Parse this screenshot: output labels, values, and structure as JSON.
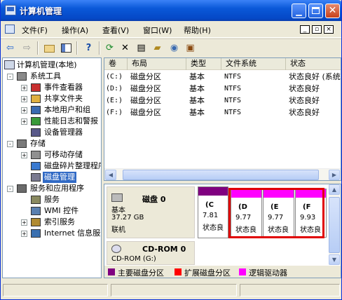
{
  "window": {
    "title": "计算机管理"
  },
  "menu": [
    "文件(F)",
    "操作(A)",
    "查看(V)",
    "窗口(W)",
    "帮助(H)"
  ],
  "mdi_buttons": [
    "_",
    "ð",
    "×"
  ],
  "toolbar_icons": [
    "back-arrow-icon",
    "forward-arrow-icon",
    "up-folder-icon",
    "show-tree-icon",
    "help-icon",
    "refresh-icon",
    "delete-icon",
    "properties-icon",
    "open-folder-icon",
    "search-icon",
    "export-icon"
  ],
  "tree": {
    "root": "计算机管理(本地)",
    "nodes": [
      {
        "label": "系统工具",
        "level": 1,
        "expander": "-",
        "icon": "tools"
      },
      {
        "label": "事件查看器",
        "level": 2,
        "expander": "+",
        "icon": "event"
      },
      {
        "label": "共享文件夹",
        "level": 2,
        "expander": "+",
        "icon": "share"
      },
      {
        "label": "本地用户和组",
        "level": 2,
        "expander": "+",
        "icon": "users"
      },
      {
        "label": "性能日志和警报",
        "level": 2,
        "expander": "+",
        "icon": "perf"
      },
      {
        "label": "设备管理器",
        "level": 2,
        "expander": "",
        "icon": "device"
      },
      {
        "label": "存储",
        "level": 1,
        "expander": "-",
        "icon": "storage"
      },
      {
        "label": "可移动存储",
        "level": 2,
        "expander": "+",
        "icon": "removable"
      },
      {
        "label": "磁盘碎片整理程序",
        "level": 2,
        "expander": "",
        "icon": "defrag"
      },
      {
        "label": "磁盘管理",
        "level": 2,
        "expander": "",
        "icon": "diskmgmt",
        "selected": true
      },
      {
        "label": "服务和应用程序",
        "level": 1,
        "expander": "-",
        "icon": "services-apps"
      },
      {
        "label": "服务",
        "level": 2,
        "expander": "",
        "icon": "services"
      },
      {
        "label": "WMI 控件",
        "level": 2,
        "expander": "",
        "icon": "wmi"
      },
      {
        "label": "索引服务",
        "level": 2,
        "expander": "+",
        "icon": "index"
      },
      {
        "label": "Internet 信息服务",
        "level": 2,
        "expander": "+",
        "icon": "iis"
      }
    ]
  },
  "list": {
    "columns": [
      "卷",
      "布局",
      "类型",
      "文件系统",
      "状态"
    ],
    "rows": [
      [
        "(C:)",
        "磁盘分区",
        "基本",
        "NTFS",
        "状态良好 (系统"
      ],
      [
        "(D:)",
        "磁盘分区",
        "基本",
        "NTFS",
        "状态良好"
      ],
      [
        "(E:)",
        "磁盘分区",
        "基本",
        "NTFS",
        "状态良好"
      ],
      [
        "(F:)",
        "磁盘分区",
        "基本",
        "NTFS",
        "状态良好"
      ]
    ]
  },
  "disk0": {
    "name": "磁盘 0",
    "type": "基本",
    "size": "37.27 GB",
    "status": "联机",
    "partitions": [
      {
        "label": "(C",
        "size": "7.81",
        "status": "状态良",
        "kind": "primary"
      },
      {
        "label": "(D",
        "size": "9.77",
        "status": "状态良",
        "kind": "logical"
      },
      {
        "label": "(E",
        "size": "9.77",
        "status": "状态良",
        "kind": "logical"
      },
      {
        "label": "(F",
        "size": "9.93",
        "status": "状态良",
        "kind": "logical"
      }
    ]
  },
  "cdrom": {
    "name": "CD-ROM 0",
    "drive": "CD-ROM (G:)"
  },
  "legend": [
    {
      "label": "主要磁盘分区",
      "color": "#800080"
    },
    {
      "label": "扩展磁盘分区",
      "color": "#ff0000"
    },
    {
      "label": "逻辑驱动器",
      "color": "#ff00ff"
    }
  ],
  "colors": {
    "primary": "#800080",
    "logical": "#ff00ff",
    "extended": "#ff0000",
    "highlight": "#e00000"
  }
}
